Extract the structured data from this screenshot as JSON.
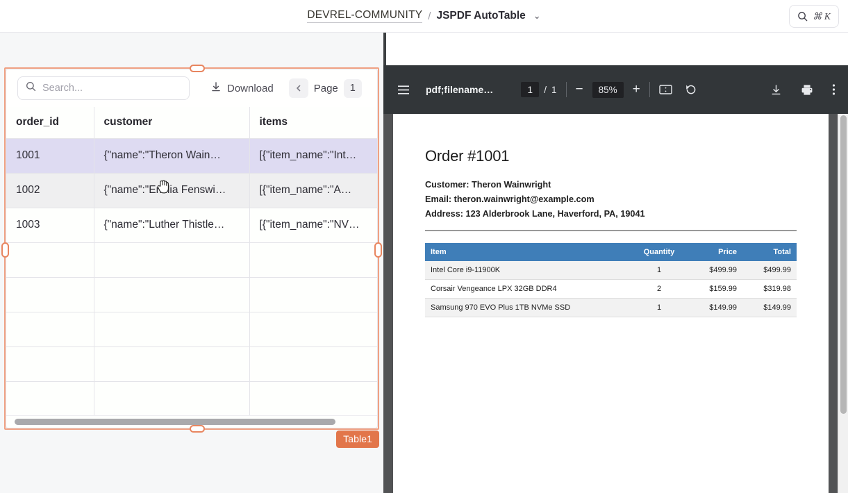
{
  "topbar": {
    "org": "DEVREL-COMMUNITY",
    "separator": "/",
    "page_title": "JSPDF AutoTable",
    "chevron": "⌄",
    "search_shortcut": "⌘ K"
  },
  "table_widget": {
    "label": "Table1",
    "search_placeholder": "Search...",
    "search_value": "",
    "download_label": "Download",
    "prev_label": "‹",
    "page_label": "Page",
    "page_number": "1",
    "columns": [
      "order_id",
      "customer",
      "items"
    ],
    "rows": [
      {
        "order_id": "1001",
        "customer": "{\"name\":\"Theron Wain…",
        "items": "[{\"item_name\":\"Int…",
        "state": "selected"
      },
      {
        "order_id": "1002",
        "customer": "{\"name\":\"Emilia Fenswi…",
        "items": "[{\"item_name\":\"A…",
        "state": "alt"
      },
      {
        "order_id": "1003",
        "customer": "{\"name\":\"Luther Thistle…",
        "items": "[{\"item_name\":\"NV…",
        "state": "normal"
      }
    ],
    "empty_row_count": 5
  },
  "pdf_viewer": {
    "filename": "pdf;filename…",
    "current_page": "1",
    "page_separator": "/",
    "total_pages": "1",
    "zoom_out": "−",
    "zoom_level": "85%",
    "zoom_in": "+",
    "icons": {
      "menu": "hamburger-menu-icon",
      "fit": "fit-page-icon",
      "rotate": "rotate-icon",
      "download": "download-icon",
      "print": "print-icon",
      "more": "more-vertical-icon"
    }
  },
  "pdf_document": {
    "heading": "Order #1001",
    "customer_line": "Customer: Theron Wainwright",
    "email_line": "Email: theron.wainwright@example.com",
    "address_line": "Address: 123 Alderbrook Lane, Haverford, PA, 19041",
    "table": {
      "headers": [
        "Item",
        "Quantity",
        "Price",
        "Total"
      ],
      "rows": [
        {
          "item": "Intel Core i9-11900K",
          "quantity": "1",
          "price": "$499.99",
          "total": "$499.99"
        },
        {
          "item": "Corsair Vengeance LPX 32GB DDR4",
          "quantity": "2",
          "price": "$159.99",
          "total": "$319.98"
        },
        {
          "item": "Samsung 970 EVO Plus 1TB NVMe SSD",
          "quantity": "1",
          "price": "$149.99",
          "total": "$149.99"
        }
      ]
    }
  },
  "colors": {
    "selection_accent": "#e2764a",
    "selection_border": "#f0a183",
    "row_selected": "#dedbf2",
    "pdf_toolbar": "#323639",
    "pdf_table_header": "#3f7eb8"
  }
}
